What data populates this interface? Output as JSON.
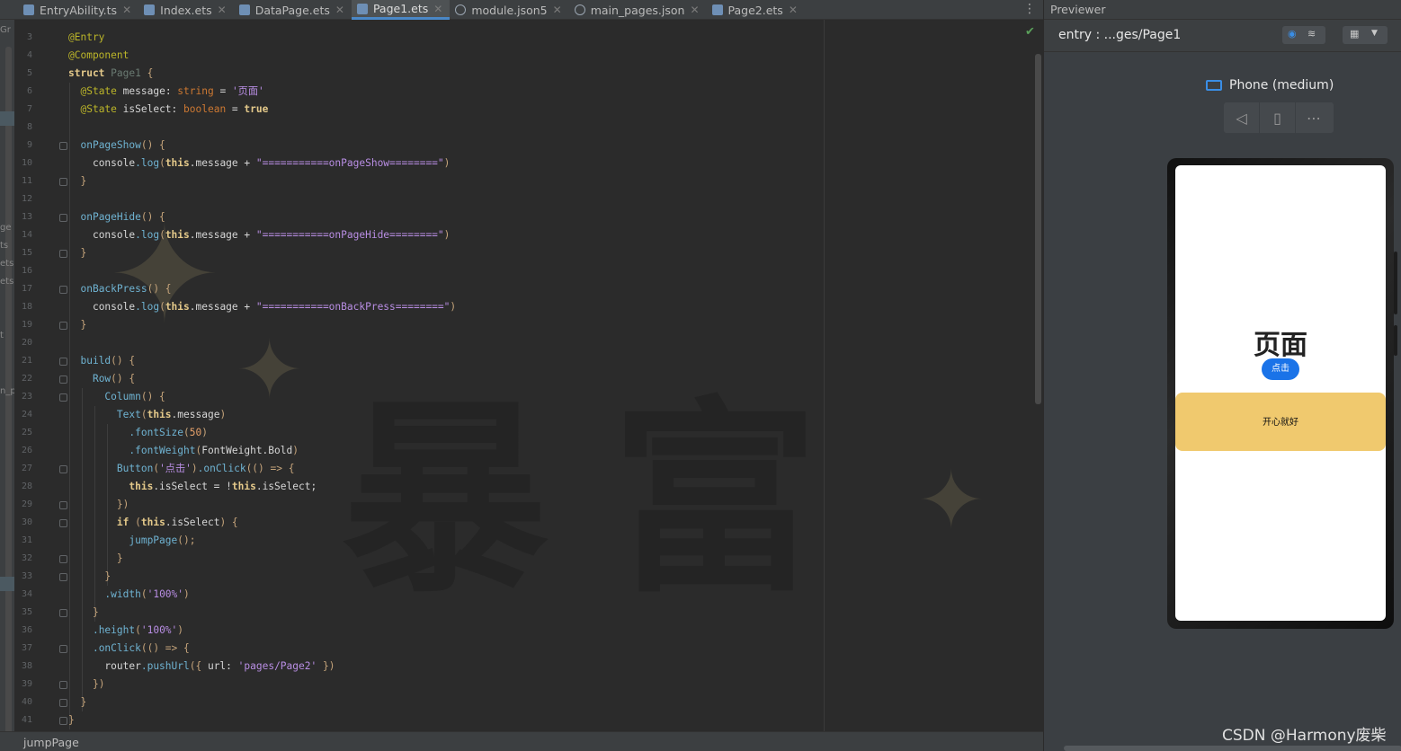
{
  "editor": {
    "tabs": [
      {
        "label": "EntryAbility.ts",
        "icon": "ts-file-icon",
        "active": false
      },
      {
        "label": "Index.ets",
        "icon": "ets-file-icon",
        "active": false
      },
      {
        "label": "DataPage.ets",
        "icon": "ets-file-icon",
        "active": false
      },
      {
        "label": "Page1.ets",
        "icon": "ets-file-icon",
        "active": true
      },
      {
        "label": "module.json5",
        "icon": "json-file-icon",
        "active": false
      },
      {
        "label": "main_pages.json",
        "icon": "json-file-icon",
        "active": false
      },
      {
        "label": "Page2.ets",
        "icon": "ets-file-icon",
        "active": false
      }
    ],
    "line_numbers": [
      "3",
      "4",
      "5",
      "6",
      "7",
      "8",
      "9",
      "10",
      "11",
      "12",
      "13",
      "14",
      "15",
      "16",
      "17",
      "18",
      "19",
      "20",
      "21",
      "22",
      "23",
      "24",
      "25",
      "26",
      "27",
      "28",
      "29",
      "30",
      "31",
      "32",
      "33",
      "34",
      "35",
      "36",
      "37",
      "38",
      "39",
      "40",
      "41"
    ],
    "left_strip_labels": [
      "Gr",
      "ge",
      "ts",
      "ets",
      "ets",
      "t",
      "n_p"
    ],
    "status_breadcrumb": "jumpPage",
    "watermark_chars": [
      "暴",
      "富"
    ]
  },
  "code": {
    "l3": "@Entry",
    "l4": "@Component",
    "l5_kw": "struct",
    "l5_name": "Page1",
    "l6_dec": "@State",
    "l6_var": "message",
    "l6_type": "string",
    "l6_val": "'页面'",
    "l7_dec": "@State",
    "l7_var": "isSelect",
    "l7_type": "boolean",
    "l7_val": "true",
    "l9_fn": "onPageShow",
    "l10_str": "\"===========onPageShow========\"",
    "l13_fn": "onPageHide",
    "l14_str": "\"===========onPageHide========\"",
    "l17_fn": "onBackPress",
    "l18_str": "\"===========onBackPress========\"",
    "l21_fn": "build",
    "l22_fn": "Row",
    "l23_fn": "Column",
    "l24_fn": "Text",
    "l25_fn": ".fontSize",
    "l25_num": "50",
    "l26_fn": ".fontWeight",
    "l26_arg": "FontWeight.Bold",
    "l27_fn": "Button",
    "l27_str": "'点击'",
    "l27_click": ".onClick",
    "l28_stmt": ".isSelect = !",
    "l28_stmt2": ".isSelect;",
    "l31_fn": "jumpPage",
    "l34_fn": ".width",
    "l34_str": "'100%'",
    "l36_fn": ".height",
    "l36_str": "'100%'",
    "l37_fn": ".onClick",
    "l38_obj": "router",
    "l38_fn": ".pushUrl",
    "l38_key": "url",
    "l38_str": "'pages/Page2'",
    "kw_this": "this",
    "kw_if": "if",
    "console": "console",
    "log": ".log",
    "msg": ".message + "
  },
  "previewer": {
    "header_label": "Previewer",
    "path": "entry : ...ges/Page1",
    "device_name": "Phone (medium)",
    "controls": [
      "back-icon",
      "rotate-icon",
      "more-icon"
    ],
    "app": {
      "title": "页面",
      "button_label": "点击",
      "row_text": "开心就好",
      "row_color": "#f0c96e",
      "button_color": "#1a73e8"
    }
  },
  "watermark": "CSDN @Harmony废柴"
}
